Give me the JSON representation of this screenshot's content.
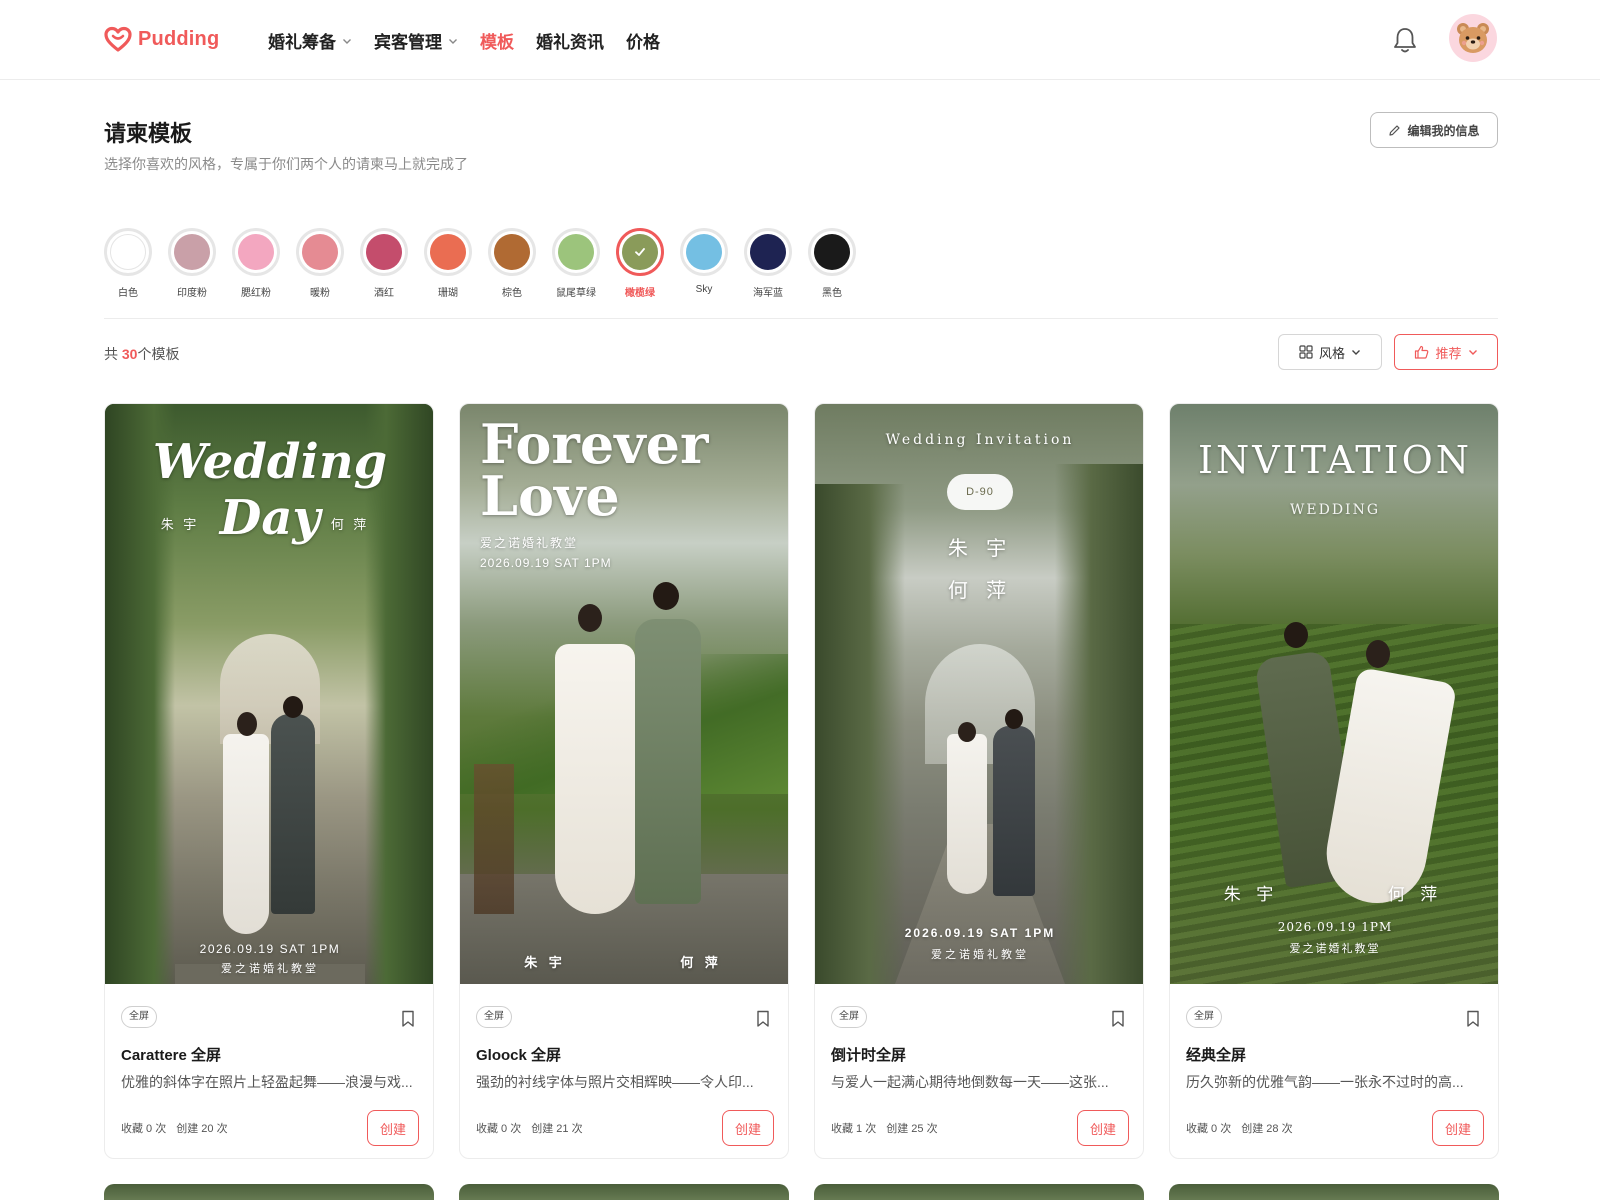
{
  "header": {
    "logo_text": "Pudding",
    "nav": [
      {
        "label": "婚礼筹备",
        "has_dropdown": true,
        "active": false
      },
      {
        "label": "宾客管理",
        "has_dropdown": true,
        "active": false
      },
      {
        "label": "模板",
        "has_dropdown": false,
        "active": true
      },
      {
        "label": "婚礼资讯",
        "has_dropdown": false,
        "active": false
      },
      {
        "label": "价格",
        "has_dropdown": false,
        "active": false
      }
    ],
    "icons": {
      "notification": "bell-icon",
      "avatar": "bear-avatar"
    }
  },
  "page": {
    "title": "请柬模板",
    "subtitle": "选择你喜欢的风格，专属于你们两个人的请柬马上就完成了",
    "edit_button": "编辑我的信息"
  },
  "colors": [
    {
      "label": "白色",
      "hex": "#ffffff"
    },
    {
      "label": "印度粉",
      "hex": "#c9a0a8"
    },
    {
      "label": "腮红粉",
      "hex": "#f3a7c0"
    },
    {
      "label": "暖粉",
      "hex": "#e58b93"
    },
    {
      "label": "酒红",
      "hex": "#c44d6c"
    },
    {
      "label": "珊瑚",
      "hex": "#ea6d52"
    },
    {
      "label": "棕色",
      "hex": "#b06a33"
    },
    {
      "label": "鼠尾草绿",
      "hex": "#9cc47c"
    },
    {
      "label": "橄榄绿",
      "hex": "#8a9b5a",
      "selected": true
    },
    {
      "label": "Sky",
      "hex": "#74bfe3"
    },
    {
      "label": "海军蓝",
      "hex": "#1e2352"
    },
    {
      "label": "黑色",
      "hex": "#1a1a1a"
    }
  ],
  "toolbar": {
    "count_prefix": "共 ",
    "count": "30",
    "count_suffix": "个模板",
    "style_filter": "风格",
    "sort": "推荐"
  },
  "accent_color": "#f05a5a",
  "cards": [
    {
      "badge": "全屏",
      "name": "Carattere 全屏",
      "desc": "优雅的斜体字在照片上轻盈起舞——浪漫与戏...",
      "fav": "收藏 0 次",
      "created": "创建 20 次",
      "button": "创建",
      "img": {
        "title": "Wedding Day",
        "groom": "朱 宇",
        "bride": "何 萍",
        "date": "2026.09.19 SAT 1PM",
        "venue": "爱之诺婚礼教堂"
      }
    },
    {
      "badge": "全屏",
      "name": "Gloock 全屏",
      "desc": "强劲的衬线字体与照片交相辉映——令人印...",
      "fav": "收藏 0 次",
      "created": "创建 21 次",
      "button": "创建",
      "img": {
        "title1": "Forever",
        "title2": "Love",
        "venue": "爱之诺婚礼教堂",
        "date": "2026.09.19 SAT 1PM",
        "groom": "朱 宇",
        "bride": "何 萍"
      }
    },
    {
      "badge": "全屏",
      "name": "倒计时全屏",
      "desc": "与爱人一起满心期待地倒数每一天——这张...",
      "fav": "收藏 1 次",
      "created": "创建 25 次",
      "button": "创建",
      "img": {
        "title": "Wedding Invitation",
        "countdown": "D-90",
        "groom": "朱 宇",
        "bride": "何 萍",
        "date": "2026.09.19 SAT 1PM",
        "venue": "爱之诺婚礼教堂"
      }
    },
    {
      "badge": "全屏",
      "name": "经典全屏",
      "desc": "历久弥新的优雅气韵——一张永不过时的高...",
      "fav": "收藏 0 次",
      "created": "创建 28 次",
      "button": "创建",
      "img": {
        "title": "INVITATION",
        "subtitle": "WEDDING",
        "groom": "朱 宇",
        "bride": "何 萍",
        "date": "2026.09.19 1PM",
        "venue": "爱之诺婚礼教堂"
      }
    }
  ]
}
